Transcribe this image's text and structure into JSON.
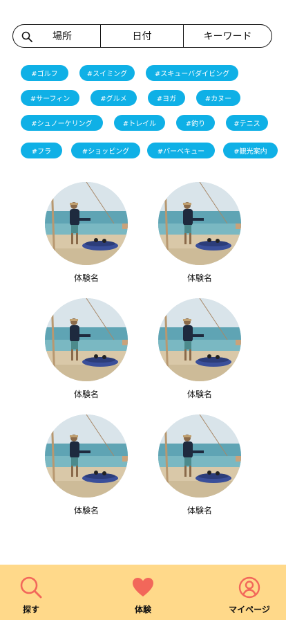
{
  "search": {
    "place_label": "場所",
    "date_label": "日付",
    "keyword_label": "キーワード"
  },
  "tags": [
    "#ゴルフ",
    "#スイミング",
    "#スキューバダイビング",
    "#サーフィン",
    "#グルメ",
    "#ヨガ",
    "#カヌー",
    "#シュノーケリング",
    "#トレイル",
    "#釣り",
    "#テニス",
    "#フラ",
    "#ショッピング",
    "#バーベキュー",
    "#観光案内"
  ],
  "experiences": [
    {
      "label": "体験名"
    },
    {
      "label": "体験名"
    },
    {
      "label": "体験名"
    },
    {
      "label": "体験名"
    },
    {
      "label": "体験名"
    },
    {
      "label": "体験名"
    }
  ],
  "nav": {
    "search_label": "探す",
    "experience_label": "体験",
    "mypage_label": "マイページ"
  },
  "colors": {
    "tag_bg": "#0fb0e6",
    "bottom_bar": "#ffd98a",
    "nav_icon": "#f2675a"
  }
}
